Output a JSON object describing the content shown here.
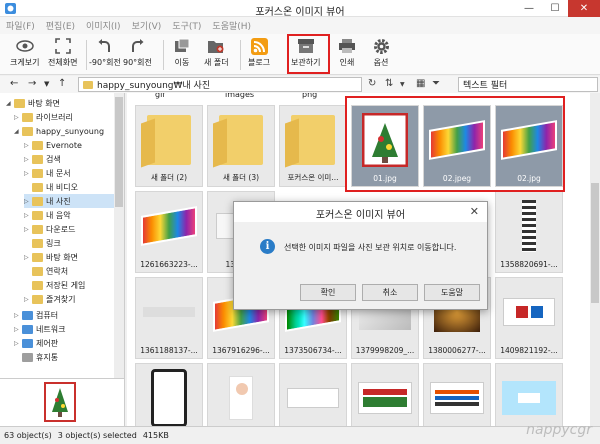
{
  "window": {
    "title": "포커스온 이미지 뷰어",
    "controls": {
      "minimize": "—",
      "maximize": "☐",
      "close": "✕"
    }
  },
  "menu": [
    "파일(F)",
    "편집(E)",
    "이미지(I)",
    "보기(V)",
    "도구(T)",
    "도움말(H)"
  ],
  "toolbar": {
    "fullview": "크게보기",
    "fullscreen": "전체화면",
    "rotate_left": "-90°회전",
    "rotate_right": "90°회전",
    "move": "이동",
    "new_folder": "새 폴더",
    "blog": "블로그",
    "archive": "보관하기",
    "print": "인쇄",
    "options": "옵션"
  },
  "address": {
    "path": "happy_sunyoung₩내 사진",
    "filter_placeholder": "텍스트 필터"
  },
  "tree": [
    {
      "label": "바탕 화면",
      "expander": "◢"
    },
    {
      "label": "라이브러리",
      "expander": "▷"
    },
    {
      "label": "happy_sunyoung",
      "expander": "◢"
    },
    {
      "label": "Evernote",
      "expander": "▷"
    },
    {
      "label": "검색",
      "expander": "▷"
    },
    {
      "label": "내 문서",
      "expander": "▷"
    },
    {
      "label": "내 비디오",
      "expander": ""
    },
    {
      "label": "내 사진",
      "expander": "▷",
      "selected": true
    },
    {
      "label": "내 음악",
      "expander": "▷"
    },
    {
      "label": "다운로드",
      "expander": "▷"
    },
    {
      "label": "링크",
      "expander": ""
    },
    {
      "label": "바탕 화면",
      "expander": "▷"
    },
    {
      "label": "연락처",
      "expander": ""
    },
    {
      "label": "저장된 게임",
      "expander": ""
    },
    {
      "label": "즐겨찾기",
      "expander": "▷"
    },
    {
      "label": "컴퓨터",
      "expander": "▷"
    },
    {
      "label": "네트워크",
      "expander": "▷"
    },
    {
      "label": "제어판",
      "expander": "▷"
    },
    {
      "label": "휴지통",
      "expander": ""
    }
  ],
  "top_partial_labels": [
    "gif",
    "images",
    "png"
  ],
  "grid": {
    "row1": [
      "새 폴더 (2)",
      "새 폴더 (3)",
      "포커스온 이미...",
      "01.jpg",
      "02.jpeg",
      "02.jpg"
    ],
    "row2": [
      "1261663223-...",
      "13151...",
      "",
      "",
      "",
      "1358820691-..."
    ],
    "row3": [
      "1361188137-...",
      "1367916296-...",
      "1373506734-...",
      "1379998209_...",
      "1380006277-...",
      "1409821192-..."
    ]
  },
  "dialog": {
    "title": "포커스온 이미지 뷰어",
    "message": "선택한 이미지 파일을 사진 보관 위치로 이동합니다.",
    "ok": "확인",
    "cancel": "취소",
    "help": "도움말",
    "close": "✕",
    "info_glyph": "i"
  },
  "status": {
    "objects": "63 object(s)",
    "selected": "3 object(s) selected",
    "size": "415KB"
  },
  "watermark": "nappycgr",
  "colors": {
    "selection": "#8e9aa8",
    "highlight": "#e02020",
    "close_button": "#c7372f",
    "info": "#2a7cc7"
  }
}
